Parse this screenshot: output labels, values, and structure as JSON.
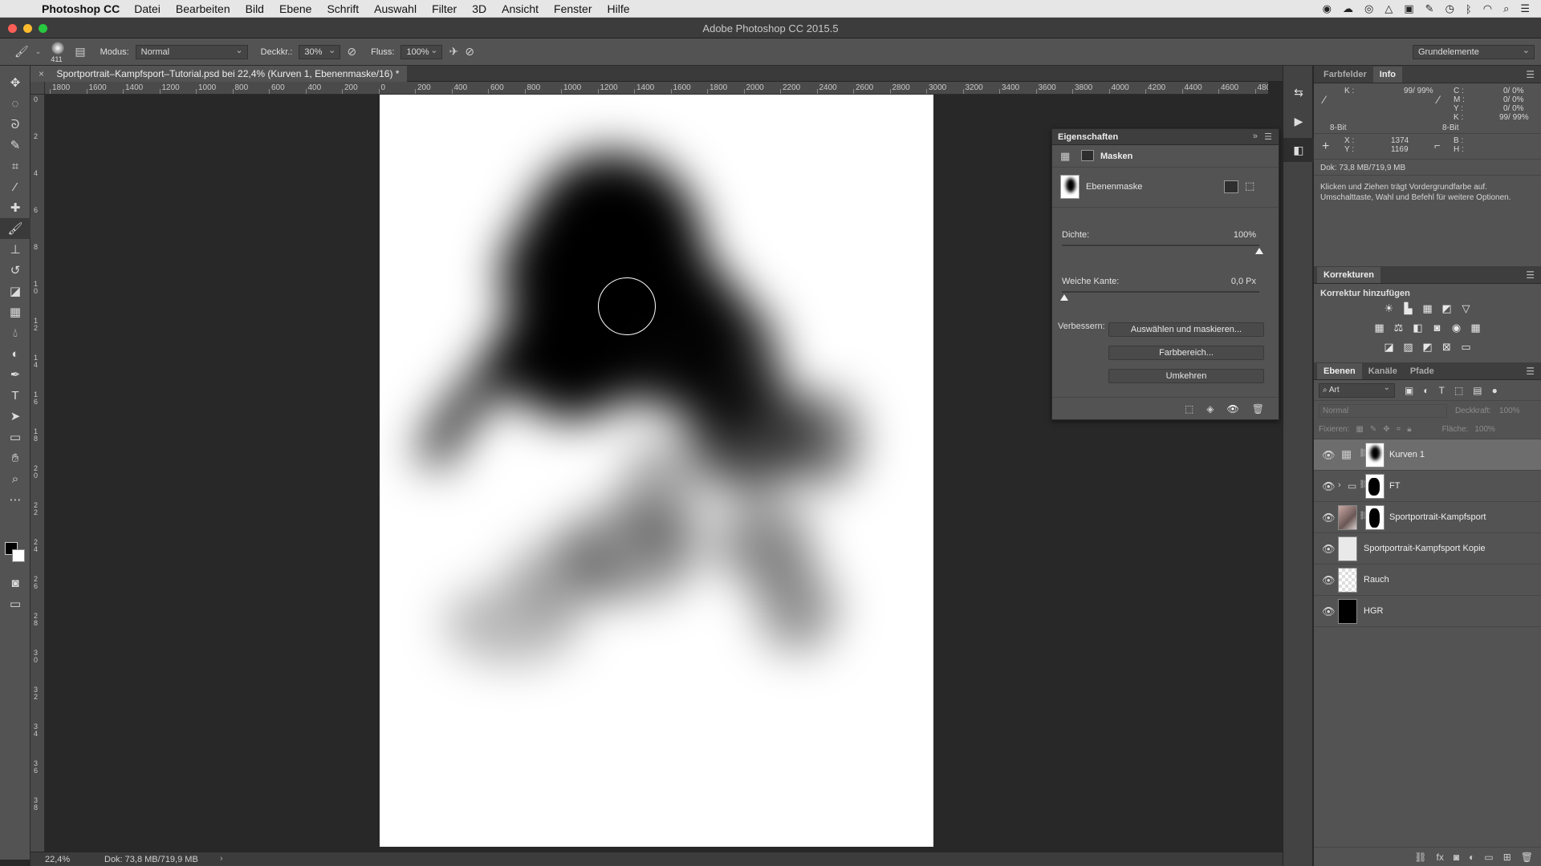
{
  "menubar": {
    "app_name": "Photoshop CC",
    "items": [
      "Datei",
      "Bearbeiten",
      "Bild",
      "Ebene",
      "Schrift",
      "Auswahl",
      "Filter",
      "3D",
      "Ansicht",
      "Fenster",
      "Hilfe"
    ]
  },
  "window": {
    "title": "Adobe Photoshop CC 2015.5"
  },
  "options": {
    "brush_size": "411",
    "mode_label": "Modus:",
    "mode_value": "Normal",
    "opacity_label": "Deckkr.:",
    "opacity_value": "30%",
    "flow_label": "Fluss:",
    "flow_value": "100%",
    "workspace": "Grundelemente"
  },
  "document": {
    "tab_title": "Sportportrait–Kampfsport–Tutorial.psd bei 22,4% (Kurven 1, Ebenenmaske/16) *",
    "close_glyph": "×"
  },
  "ruler": {
    "h_ticks": [
      "1800",
      "1600",
      "1400",
      "1200",
      "1000",
      "800",
      "600",
      "400",
      "200",
      "0",
      "200",
      "400",
      "600",
      "800",
      "1000",
      "1200",
      "1400",
      "1600",
      "1800",
      "2000",
      "2200",
      "2400",
      "2600",
      "2800",
      "3000",
      "3200",
      "3400",
      "3600",
      "3800",
      "4000",
      "4200",
      "4400",
      "4600",
      "4800"
    ],
    "v_ticks": [
      "0",
      "2",
      "4",
      "6",
      "8",
      "10",
      "12",
      "14",
      "16",
      "18",
      "20",
      "22",
      "24",
      "26",
      "28",
      "30",
      "32",
      "34",
      "36",
      "38"
    ]
  },
  "status": {
    "zoom": "22,4%",
    "doc": "Dok: 73,8 MB/719,9 MB",
    "arrow": "›"
  },
  "info_panel": {
    "tab_farbfelder": "Farbfelder",
    "tab_info": "Info",
    "k_label": "K :",
    "k_value": "99/  99%",
    "bit_left": "8-Bit",
    "bit_right": "8-Bit",
    "cmyk_labels": [
      "C :",
      "M :",
      "Y :",
      "K :"
    ],
    "cmyk_values": [
      "0/   0%",
      "0/   0%",
      "0/   0%",
      "99/  99%"
    ],
    "x_label": "X :",
    "y_label": "Y :",
    "x_value": "1374",
    "y_value": "1169",
    "b_label": "B :",
    "h_label": "H :",
    "doc": "Dok: 73,8 MB/719,9 MB",
    "hint": "Klicken und Ziehen trägt Vordergrundfarbe auf. Umschalttaste, Wahl und Befehl für weitere Optionen."
  },
  "korrekturen": {
    "title": "Korrekturen",
    "subtitle": "Korrektur hinzufügen"
  },
  "layers_panel": {
    "tabs": [
      "Ebenen",
      "Kanäle",
      "Pfade"
    ],
    "filter": "Art",
    "blend": "Normal",
    "opacity_label": "Deckkraft:",
    "opacity_value": "100%",
    "lock_label": "Fixieren:",
    "fill_label": "Fläche:",
    "fill_value": "100%",
    "layers": [
      {
        "name": "Kurven 1"
      },
      {
        "name": "FT"
      },
      {
        "name": "Sportportrait-Kampfsport"
      },
      {
        "name": "Sportportrait-Kampfsport Kopie"
      },
      {
        "name": "Rauch"
      },
      {
        "name": "HGR"
      }
    ]
  },
  "properties": {
    "title": "Eigenschaften",
    "mask_type": "Masken",
    "mask_name": "Ebenenmaske",
    "density_label": "Dichte:",
    "density_value": "100%",
    "density_fraction": 1.0,
    "feather_label": "Weiche Kante:",
    "feather_value": "0,0 Px",
    "feather_fraction": 0.0,
    "refine_label": "Verbessern:",
    "btn_select_mask": "Auswählen und maskieren...",
    "btn_color_range": "Farbbereich...",
    "btn_invert": "Umkehren"
  }
}
